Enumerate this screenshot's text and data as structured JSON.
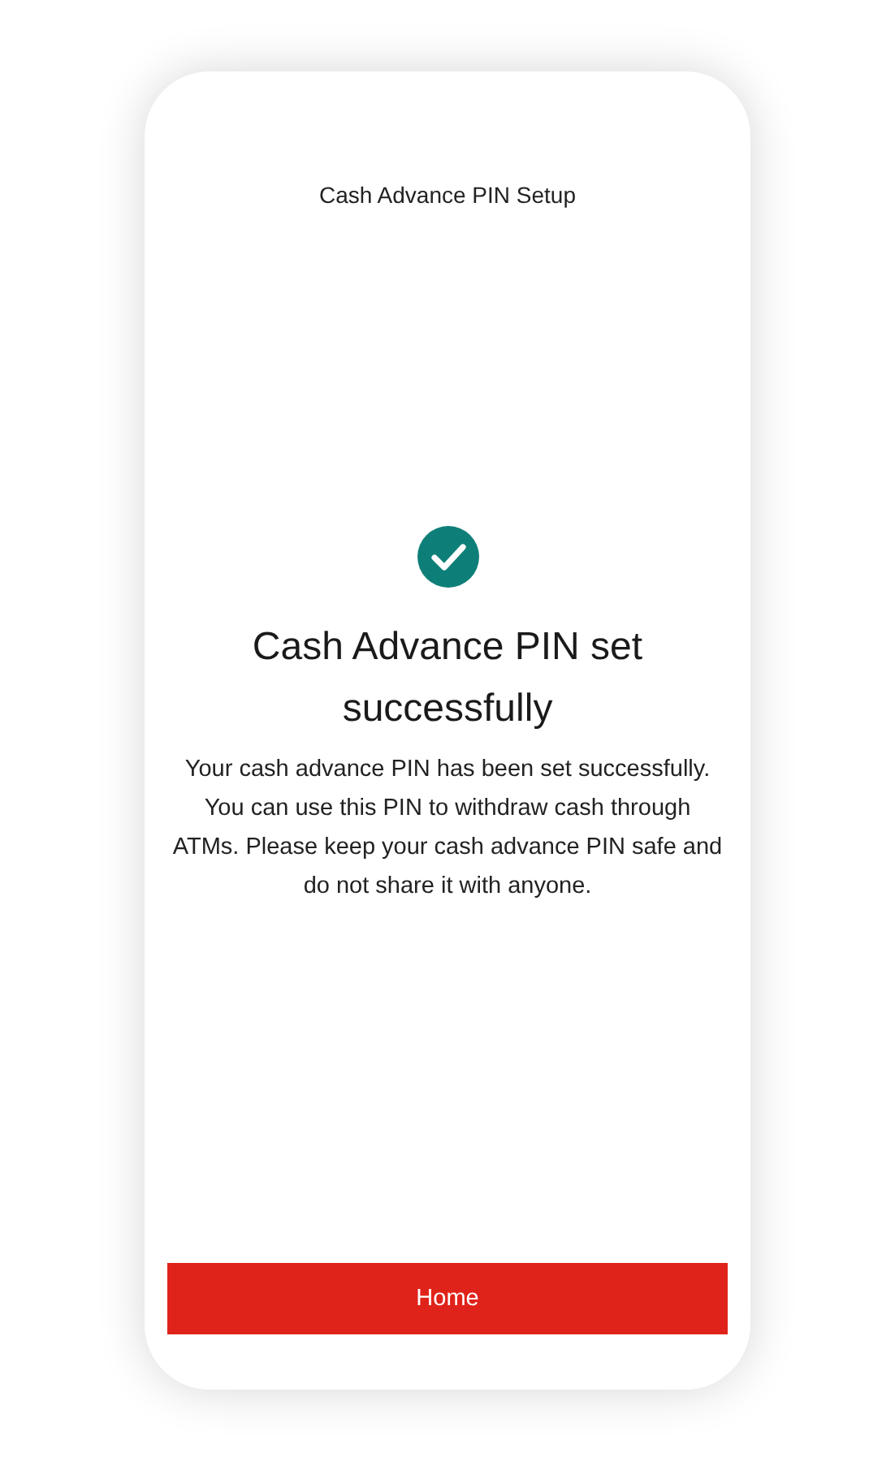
{
  "header": {
    "title": "Cash Advance PIN Setup"
  },
  "result": {
    "heading": "Cash Advance PIN set successfully",
    "message": "Your cash advance PIN has been set successfully. You can use this PIN to withdraw cash through ATMs. Please keep your cash advance PIN safe and do not share it with anyone."
  },
  "button": {
    "label": "Home"
  }
}
